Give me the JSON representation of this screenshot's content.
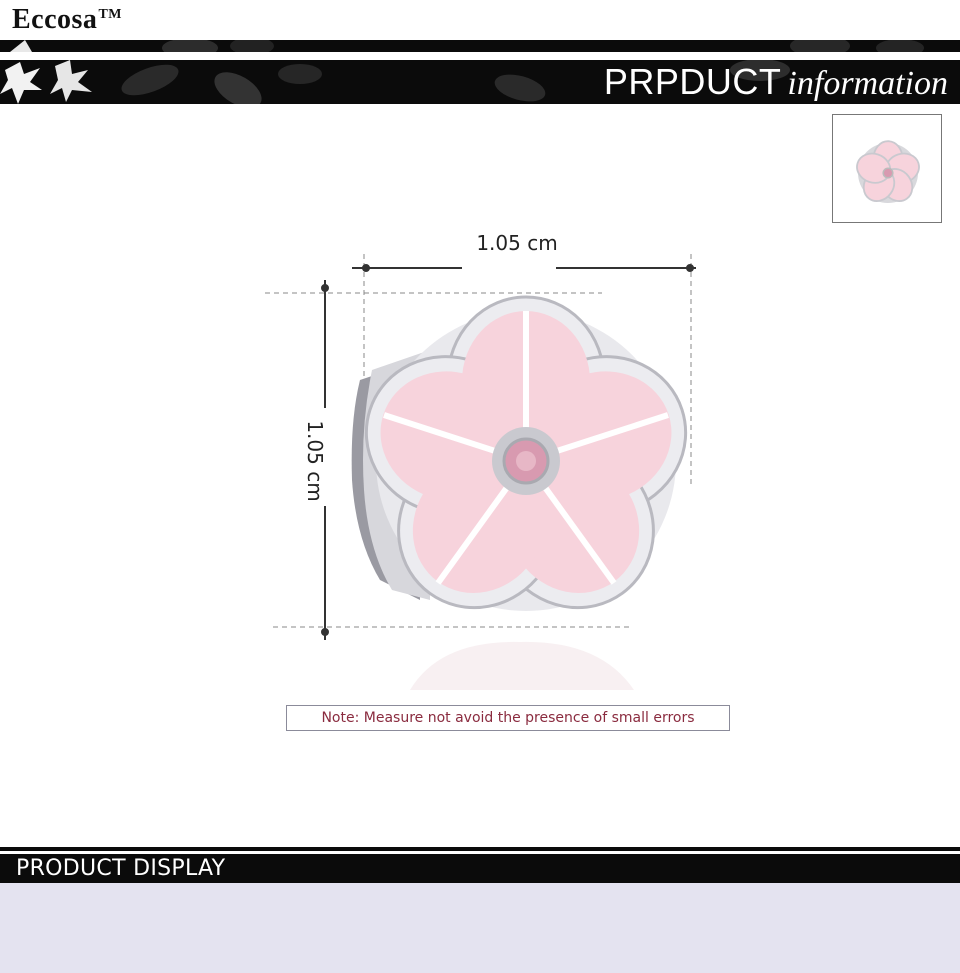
{
  "header": {
    "brand": "Eccosa",
    "brand_tm": "TM",
    "banner_title_main": "PRPDUCT",
    "banner_title_script": "information"
  },
  "dimensions": {
    "width_label": "1.05 cm",
    "height_label": "1.05 cm"
  },
  "note": "Note: Measure not avoid the presence of small errors",
  "section": {
    "title": "PRODUCT  DISPLAY"
  },
  "colors": {
    "banner": "#0b0b0b",
    "petal": "#f7d3dc",
    "petal_edge": "#c9c9cf",
    "gem": "#d89ab0",
    "note_text": "#8a2b3f",
    "display_bg": "#e4e3f0"
  }
}
